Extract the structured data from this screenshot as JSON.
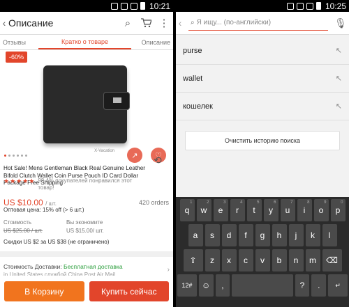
{
  "status_time_left": "10:21",
  "status_time_right": "10:25",
  "left": {
    "title": "Описание",
    "tabs": [
      "Отзывы",
      "Кратко о товаре",
      "Описание"
    ],
    "badge": "-60%",
    "image_caption": "X-Vacation",
    "product_title": "Hot Sale! Mens Gentleman Black Real Genuine Leather Bifold Clutch Wallet Coin Purse Pouch ID Card Dollar Package Free Shipping",
    "stars": "★★★★★",
    "rating_text": "98,4% покупателей понравился этот товар!",
    "price": "US $10.00",
    "price_unit": "/ шт.",
    "orders": "420 orders",
    "wholesale": "Оптовая цена: 15% off (> 6 шт.)",
    "cost_label": "Стоимость",
    "cost_value": "US $25.00 / шт.",
    "savings_label": "Вы экономите",
    "savings_value": "US $15.00/ шт.",
    "discount": "Скидки US $2 за US $38 (не ограничено)",
    "shipping_label": "Стоимость Доставки:",
    "shipping_value": "Бесплатная доставка",
    "shipping_sub": "in United States службой China Post Air Mail",
    "cart_button": "В Корзину",
    "buy_button": "Купить сейчас"
  },
  "right": {
    "search_placeholder": "Я ищу... (по-английски)",
    "suggestions": [
      "purse",
      "wallet",
      "кошелек"
    ],
    "clear_button": "Очистить историю поиска",
    "keyboard": {
      "row1": [
        "q",
        "w",
        "e",
        "r",
        "t",
        "y",
        "u",
        "i",
        "o",
        "p"
      ],
      "row1_sub": [
        "1",
        "2",
        "3",
        "4",
        "5",
        "6",
        "7",
        "8",
        "9",
        "0"
      ],
      "row2": [
        "a",
        "s",
        "d",
        "f",
        "g",
        "h",
        "j",
        "k",
        "l"
      ],
      "row3": [
        "⇧",
        "z",
        "x",
        "c",
        "v",
        "b",
        "n",
        "m",
        "⌫"
      ],
      "row4": [
        "12#",
        "☺",
        ",",
        "",
        "?",
        ".",
        "↵"
      ]
    }
  }
}
